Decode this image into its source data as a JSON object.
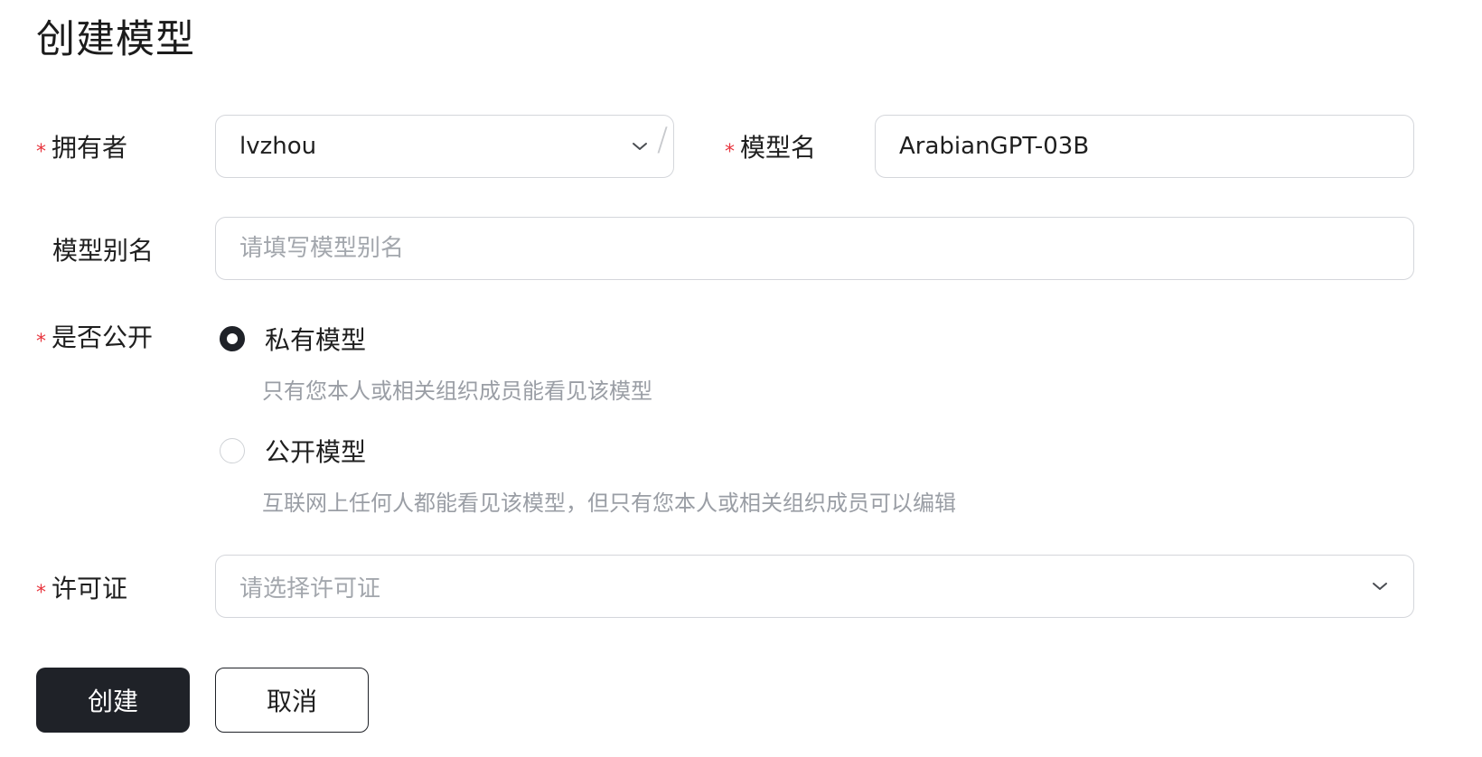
{
  "page": {
    "title": "创建模型"
  },
  "form": {
    "required_mark": "*",
    "owner": {
      "label": "拥有者",
      "value": "lvzhou",
      "icon": "chevron-down-icon"
    },
    "separator": "/",
    "model_name": {
      "label": "模型名",
      "value": "ArabianGPT-03B"
    },
    "model_alias": {
      "label": "模型别名",
      "placeholder": "请填写模型别名"
    },
    "visibility": {
      "label": "是否公开",
      "options": [
        {
          "label": "私有模型",
          "description": "只有您本人或相关组织成员能看见该模型",
          "checked": true
        },
        {
          "label": "公开模型",
          "description": "互联网上任何人都能看见该模型，但只有您本人或相关组织成员可以编辑",
          "checked": false
        }
      ]
    },
    "license": {
      "label": "许可证",
      "placeholder": "请选择许可证",
      "icon": "chevron-down-icon"
    }
  },
  "actions": {
    "create_label": "创建",
    "cancel_label": "取消"
  },
  "colors": {
    "primary": "#1f2228",
    "required": "#e8363f",
    "border": "#d4d6db",
    "placeholder": "#a3a7ad",
    "description": "#9a9ea5"
  }
}
